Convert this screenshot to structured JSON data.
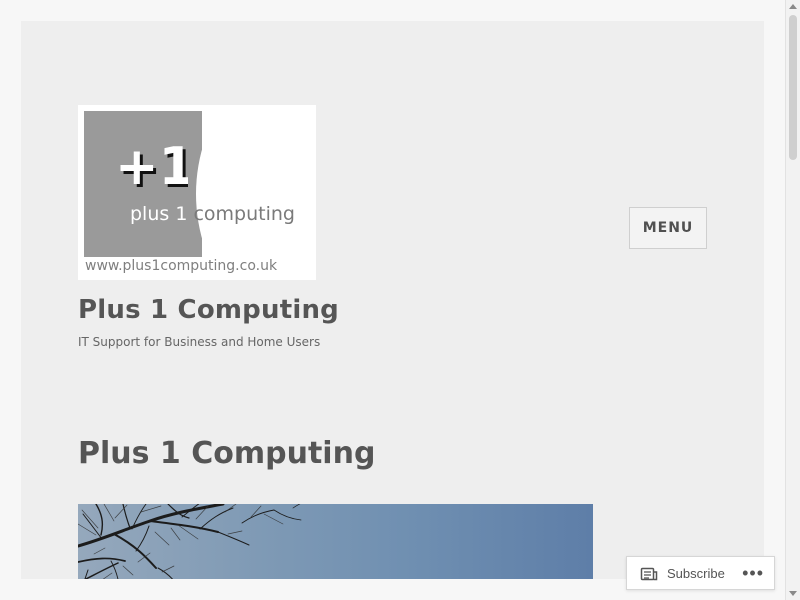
{
  "header": {
    "logo": {
      "symbol": "+1",
      "brand_light": "plus 1",
      "brand_dark": "computing",
      "url": "www.plus1computing.co.uk"
    },
    "site_title": "Plus 1 Computing",
    "tagline": "IT Support for Business and Home Users",
    "menu_label": "MENU"
  },
  "content": {
    "page_heading": "Plus 1 Computing"
  },
  "subscribe_widget": {
    "label": "Subscribe",
    "more_label": "•••",
    "icon": "subscribe-icon"
  },
  "colors": {
    "page_background": "#f7f7f7",
    "card_background": "#eeeeee",
    "title_color": "#555555",
    "tagline_color": "#666666",
    "sky_blue": "#6f8fb1"
  }
}
